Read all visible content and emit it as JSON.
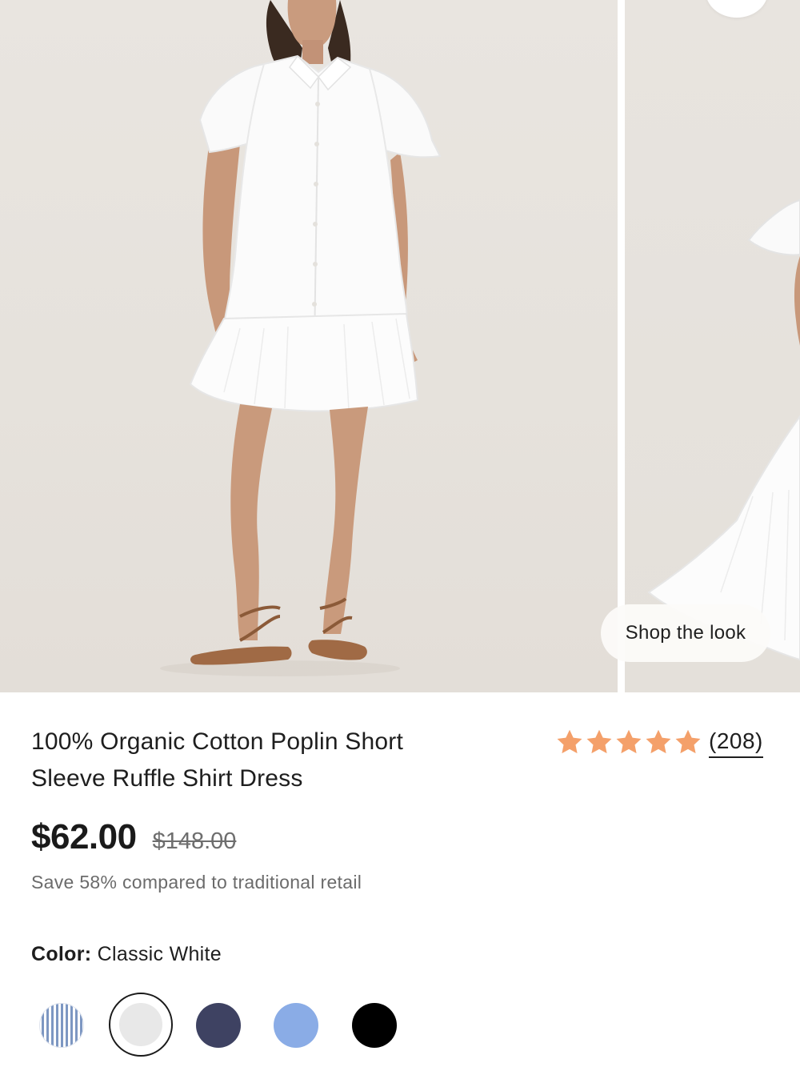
{
  "carousel": {
    "shop_the_look_label": "Shop the look"
  },
  "product": {
    "title_line1": "100% Organic Cotton Poplin Short",
    "title_line2": "Sleeve Ruffle Shirt Dress",
    "rating": {
      "stars": 5,
      "star_color": "#f4a06a",
      "review_count": "(208)"
    },
    "price": {
      "current": "$62.00",
      "original": "$148.00"
    },
    "savings_text": "Save 58% compared to traditional retail",
    "color": {
      "label": "Color:",
      "selected": "Classic White",
      "swatches": [
        {
          "name": "blue-stripe",
          "color": "#7d97c2"
        },
        {
          "name": "classic-white",
          "color": "#e8e8e8",
          "selected": true
        },
        {
          "name": "navy",
          "color": "#3e4262"
        },
        {
          "name": "light-blue",
          "color": "#8aace6"
        },
        {
          "name": "black",
          "color": "#000000"
        }
      ]
    }
  },
  "colors": {
    "text": "#1e1e1e",
    "muted": "#6b6b6b",
    "accent_star": "#f4a06a"
  }
}
